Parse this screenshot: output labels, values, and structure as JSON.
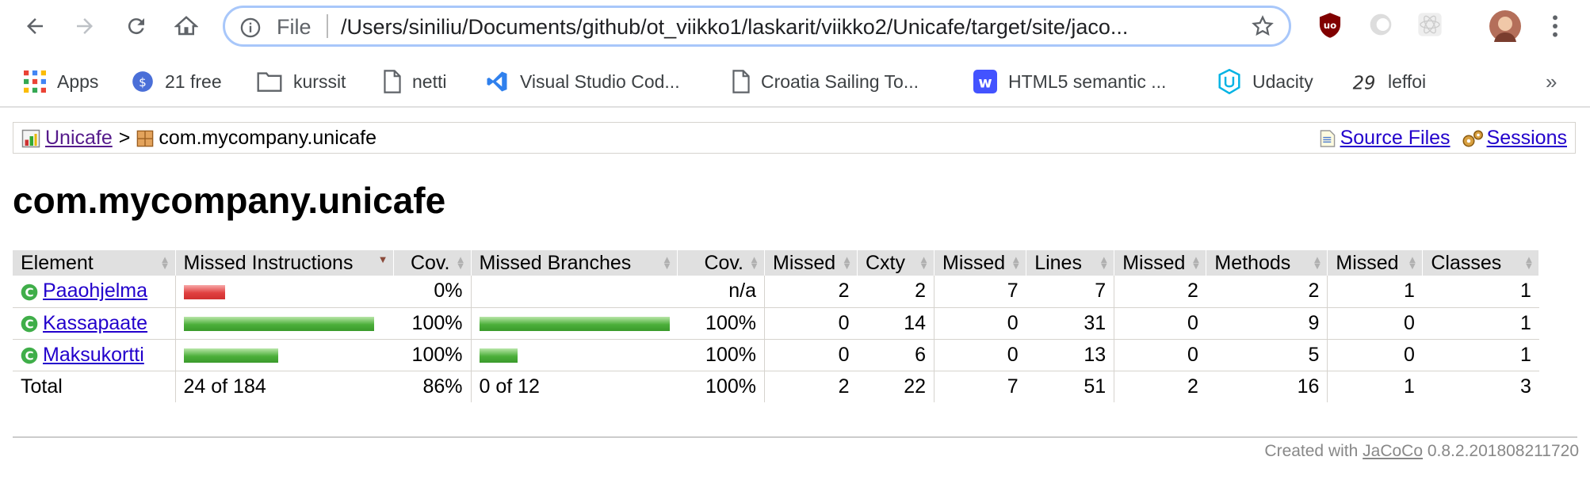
{
  "browser": {
    "file_label": "File",
    "url": "/Users/siniliu/Documents/github/ot_viikko1/laskarit/viikko2/Unicafe/target/site/jaco...",
    "bookmarks": [
      {
        "label": "Apps",
        "icon": "apps-grid-icon"
      },
      {
        "label": "21 free",
        "icon": "coin-icon"
      },
      {
        "label": "kurssit",
        "icon": "folder-icon"
      },
      {
        "label": "netti",
        "icon": "page-icon"
      },
      {
        "label": "Visual Studio Cod...",
        "icon": "vscode-icon"
      },
      {
        "label": "Croatia Sailing To...",
        "icon": "page-icon"
      },
      {
        "label": "HTML5 semantic ...",
        "icon": "webflow-icon"
      },
      {
        "label": "Udacity",
        "icon": "udacity-icon"
      },
      {
        "label": "leffoi",
        "icon": "leffoi-icon"
      }
    ],
    "overflow": "»"
  },
  "breadcrumb": {
    "root": "Unicafe",
    "separator": ">",
    "current": "com.mycompany.unicafe",
    "source_files": "Source Files",
    "sessions": "Sessions"
  },
  "heading": "com.mycompany.unicafe",
  "table": {
    "headers": [
      "Element",
      "Missed Instructions",
      "Cov.",
      "Missed Branches",
      "Cov.",
      "Missed",
      "Cxty",
      "Missed",
      "Lines",
      "Missed",
      "Methods",
      "Missed",
      "Classes"
    ],
    "rows": [
      {
        "name": "Paaohjelma",
        "instr_cov": "0%",
        "instr_bar_covered": 0,
        "branch_cov": "n/a",
        "branch_bar_covered": null,
        "missed_cxty": "2",
        "cxty": "2",
        "missed_lines": "7",
        "lines": "7",
        "missed_methods": "2",
        "methods": "2",
        "missed_classes": "1",
        "classes": "1"
      },
      {
        "name": "Kassapaate",
        "instr_cov": "100%",
        "instr_bar_covered": 1,
        "branch_cov": "100%",
        "branch_bar_covered": 1,
        "missed_cxty": "0",
        "cxty": "14",
        "missed_lines": "0",
        "lines": "31",
        "missed_methods": "0",
        "methods": "9",
        "missed_classes": "0",
        "classes": "1"
      },
      {
        "name": "Maksukortti",
        "instr_cov": "100%",
        "instr_bar_covered": 1,
        "branch_cov": "100%",
        "branch_bar_covered": 1,
        "missed_cxty": "0",
        "cxty": "6",
        "missed_lines": "0",
        "lines": "13",
        "missed_methods": "0",
        "methods": "5",
        "missed_classes": "0",
        "classes": "1"
      }
    ],
    "total": {
      "label": "Total",
      "instr": "24 of 184",
      "instr_cov": "86%",
      "branch": "0 of 12",
      "branch_cov": "100%",
      "missed_cxty": "2",
      "cxty": "22",
      "missed_lines": "7",
      "lines": "51",
      "missed_methods": "2",
      "methods": "16",
      "missed_classes": "1",
      "classes": "3"
    }
  },
  "footer": {
    "prefix": "Created with",
    "link": "JaCoCo",
    "version": "0.8.2.201808211720"
  }
}
